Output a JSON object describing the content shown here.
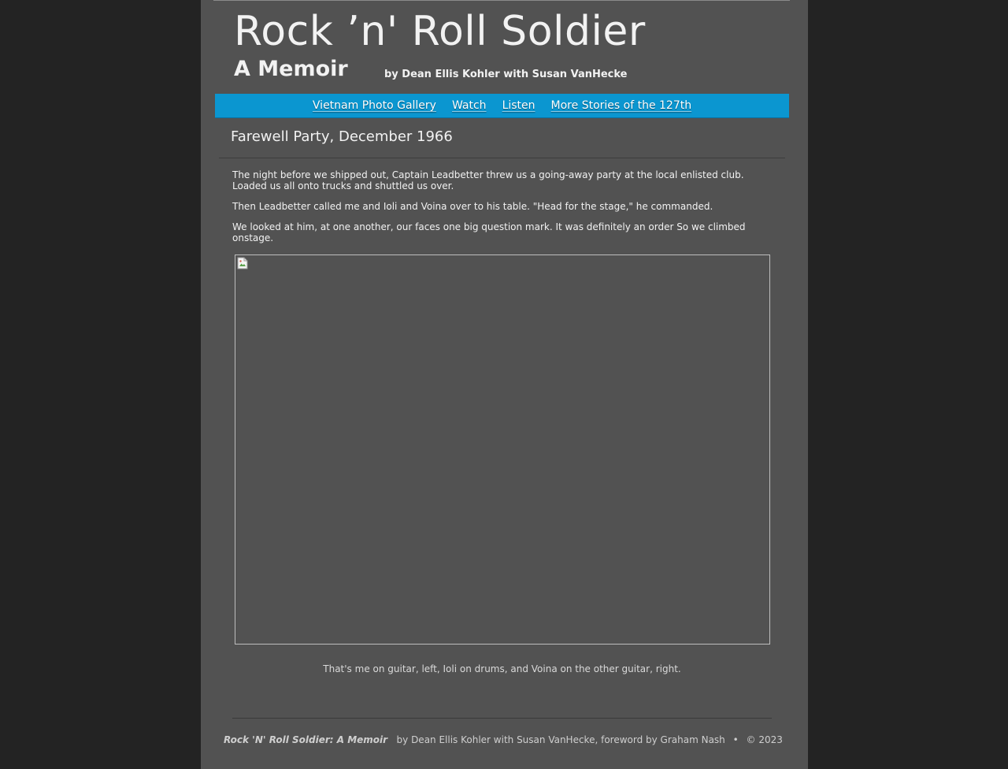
{
  "header": {
    "title": "Rock ’n' Roll Soldier",
    "subtitle": "A Memoir",
    "byline": "by Dean Ellis Kohler with Susan VanHecke"
  },
  "nav": {
    "items": [
      {
        "label": "Vietnam Photo Gallery"
      },
      {
        "label": "Watch"
      },
      {
        "label": "Listen"
      },
      {
        "label": "More Stories of the 127th"
      }
    ]
  },
  "main": {
    "heading": "Farewell Party, December 1966",
    "paragraphs": [
      "The night before we shipped out, Captain Leadbetter threw us a going-away party at the local enlisted club. Loaded us all onto trucks and shuttled us over.",
      "Then Leadbetter called me and Ioli and Voina over to his table. \"Head for the stage,\" he commanded.",
      "We looked at him, at one another, our faces one big question mark. It was definitely an order  So we climbed onstage."
    ],
    "photo_icon": "broken-image-icon",
    "caption": "That's me on guitar, left, Ioli on drums, and Voina on the other guitar, right."
  },
  "footer": {
    "book_title": "Rock 'N' Roll Soldier: A Memoir",
    "credits": "by Dean Ellis Kohler with Susan VanHecke, foreword by Graham Nash",
    "separator": "•",
    "copyright": "© 2023"
  },
  "colors": {
    "background": "#232323",
    "page": "#525252",
    "nav": "#0b96d0",
    "text": "#f2f2f2"
  }
}
